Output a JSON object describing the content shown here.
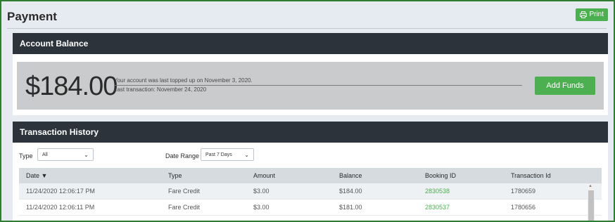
{
  "header": {
    "title": "Payment",
    "print_label": "Print"
  },
  "balance": {
    "section_title": "Account Balance",
    "amount": "$184.00",
    "topup_text": "Your account was last topped up on November 3, 2020.",
    "last_transaction_text": "Last transaction: November 24, 2020",
    "add_funds_label": "Add Funds"
  },
  "history": {
    "section_title": "Transaction History",
    "type_label": "Type",
    "type_value": "All",
    "range_label": "Date Range",
    "range_value": "Past 7 Days",
    "columns": [
      "Date ▼",
      "Type",
      "Amount",
      "Balance",
      "Booking ID",
      "Transaction Id"
    ],
    "rows": [
      [
        "11/24/2020 12:06:17 PM",
        "Fare Credit",
        "$3.00",
        "$184.00",
        "2830538",
        "1780659"
      ],
      [
        "11/24/2020 12:06:11 PM",
        "Fare Credit",
        "$3.00",
        "$181.00",
        "2830537",
        "1780656"
      ]
    ]
  },
  "colors": {
    "accent": "#4caf50",
    "panel_header": "#2c333b",
    "border": "#2e7d32"
  }
}
